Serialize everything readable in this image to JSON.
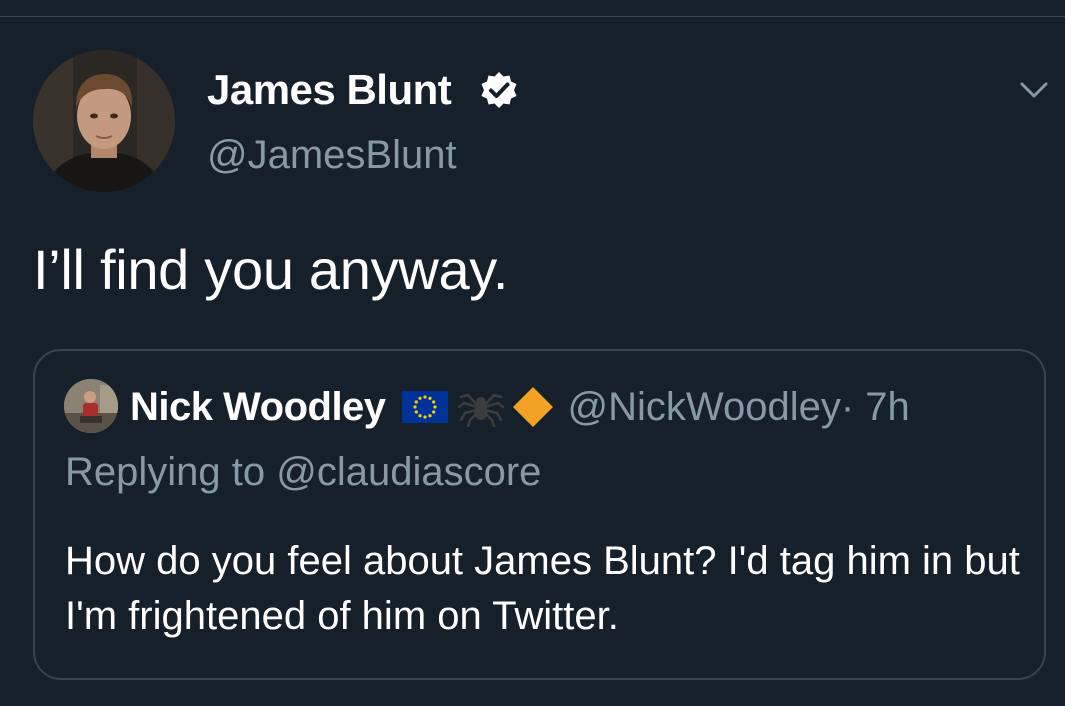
{
  "tweet": {
    "author": {
      "name": "James Blunt",
      "handle": "@JamesBlunt",
      "verified": true,
      "avatar": "profile-photo"
    },
    "text": "I’ll find you anyway.",
    "menu_icon": "chevron-down-icon"
  },
  "quoted_tweet": {
    "author": {
      "name": "Nick Woodley",
      "handle": "@NickWoodley",
      "badges": [
        "eu-flag-icon",
        "spider-icon",
        "orange-diamond-icon"
      ],
      "avatar": "profile-photo"
    },
    "time": " · 7h",
    "reply_context": "Replying to @claudiascore",
    "text": "How do you feel about James Blunt? I'd tag him in but I'm frightened of him on Twitter."
  },
  "colors": {
    "background": "#15202b",
    "border": "#38444d",
    "secondary_text": "#8899a6",
    "verified_badge": "#ffffff",
    "eu_blue": "#003399",
    "eu_stars": "#ffcc00",
    "diamond": "#f4a223"
  }
}
